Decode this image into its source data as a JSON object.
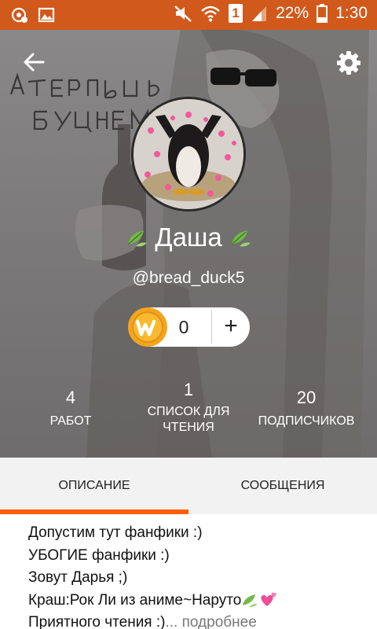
{
  "status_bar": {
    "battery_percent": "22%",
    "time": "1:30",
    "sim_slot": "1",
    "icons": [
      "notification-icon",
      "gallery-icon",
      "mute-icon",
      "wifi-icon",
      "sim-icon",
      "signal-icon",
      "battery-icon"
    ]
  },
  "header": {
    "background_text": [
      "А ТЕПЕРЬ",
      "БУХНЁМ"
    ],
    "icons": [
      "back-arrow-icon",
      "settings-gear-icon"
    ]
  },
  "profile": {
    "name": "Даша",
    "handle": "@bread_duck5",
    "coins": "0",
    "add_coins": "+"
  },
  "stats": [
    {
      "number": "4",
      "label": "РАБОТ"
    },
    {
      "number": "1",
      "label_line1": "СПИСОК ДЛЯ",
      "label_line2": "ЧТЕНИЯ"
    },
    {
      "number": "20",
      "label": "ПОДПИСЧИКОВ"
    }
  ],
  "tabs": {
    "description": "ОПИСАНИЕ",
    "messages": "СООБЩЕНИЯ",
    "active": "description"
  },
  "description_lines": [
    "Допустим тут фанфики :)",
    "УБОГИЕ фанфики :)",
    "Зовут Дарья ;)",
    "Краш:Рок Ли из аниме~Наруто",
    "Приятного чтения :)"
  ],
  "more_link": "... подробнее",
  "colors": {
    "status_bar": "#d2591c",
    "accent": "#ff5c0a",
    "coin": "#f4a51c"
  }
}
